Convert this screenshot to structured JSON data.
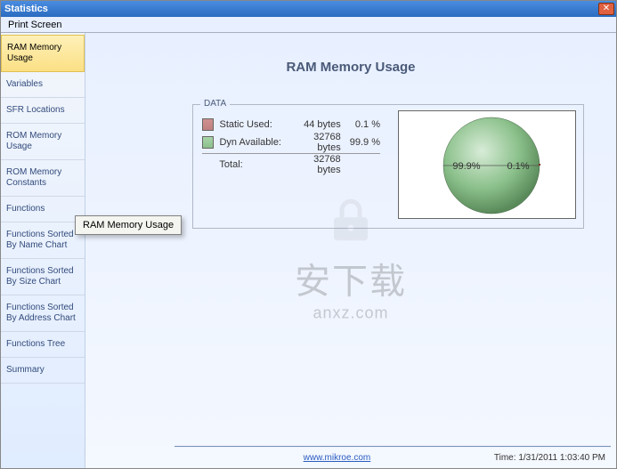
{
  "window": {
    "title": "Statistics",
    "close_label": "✕"
  },
  "menubar": {
    "print_screen": "Print Screen"
  },
  "sidebar": {
    "items": [
      {
        "label": "RAM Memory Usage"
      },
      {
        "label": "Variables"
      },
      {
        "label": "SFR Locations"
      },
      {
        "label": "ROM Memory Usage"
      },
      {
        "label": "ROM Memory Constants"
      },
      {
        "label": "Functions"
      },
      {
        "label": "Functions Sorted By Name Chart"
      },
      {
        "label": "Functions Sorted By Size Chart"
      },
      {
        "label": "Functions Sorted By Address Chart"
      },
      {
        "label": "Functions Tree"
      },
      {
        "label": "Summary"
      }
    ]
  },
  "page": {
    "title": "RAM Memory Usage",
    "fieldset_legend": "DATA",
    "rows": {
      "static": {
        "label": "Static Used:",
        "bytes": "44 bytes",
        "pct": "0.1 %"
      },
      "dyn": {
        "label": "Dyn Available:",
        "bytes": "32768 bytes",
        "pct": "99.9 %"
      },
      "total": {
        "label": "Total:",
        "bytes": "32768 bytes"
      }
    },
    "tooltip": "RAM Memory Usage"
  },
  "chart_data": {
    "type": "pie",
    "title": "",
    "series": [
      {
        "name": "Dyn Available",
        "value": 99.9,
        "color": "#8bc08b"
      },
      {
        "name": "Static Used",
        "value": 0.1,
        "color": "#c08080"
      }
    ],
    "labels": {
      "left": "99.9%",
      "right": "0.1%"
    }
  },
  "watermark": {
    "big": "安下载",
    "url": "anxz.com"
  },
  "footer": {
    "link": "www.mikroe.com",
    "time_prefix": "Time:",
    "time_value": "1/31/2011 1:03:40 PM"
  },
  "colors": {
    "accent_blue": "#2a6bc0",
    "swatch_static": "#c08080",
    "swatch_dyn": "#8bc08b"
  }
}
